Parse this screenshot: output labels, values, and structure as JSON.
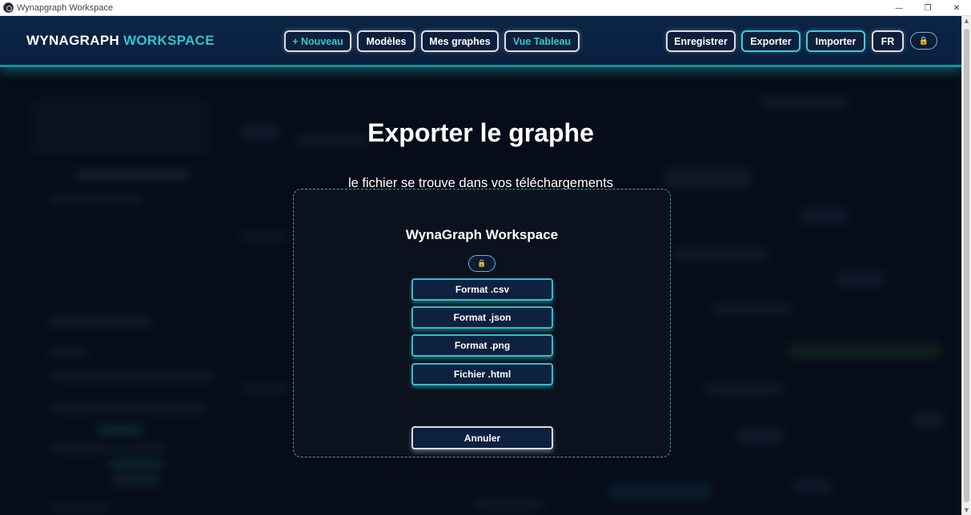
{
  "window": {
    "title": "Wynapgraph Workspace",
    "controls": {
      "minimize": "—",
      "restore": "❐",
      "close": "✕"
    }
  },
  "header": {
    "brand_main": "WYNAGRAPH",
    "brand_accent": "WORKSPACE",
    "nav": {
      "new": "+ Nouveau",
      "models": "Modèles",
      "my_graphs": "Mes graphes",
      "table_view": "Vue Tableau"
    },
    "actions": {
      "save": "Enregistrer",
      "export": "Exporter",
      "import": "Importer",
      "language": "FR"
    },
    "lock_icon": "🔒"
  },
  "modal": {
    "title": "Exporter le graphe",
    "subtitle": "le fichier se trouve dans vos téléchargements",
    "box_title": "WynaGraph Workspace",
    "lock_icon": "🔒",
    "formats": {
      "csv": "Format .csv",
      "json": "Format .json",
      "png": "Format .png",
      "html": "Fichier .html"
    },
    "cancel": "Annuler"
  },
  "colors": {
    "accent": "#2ec4cf",
    "header_bg": "#0b2445",
    "page_bg": "#0a1120",
    "button_bg": "#0f2140"
  }
}
